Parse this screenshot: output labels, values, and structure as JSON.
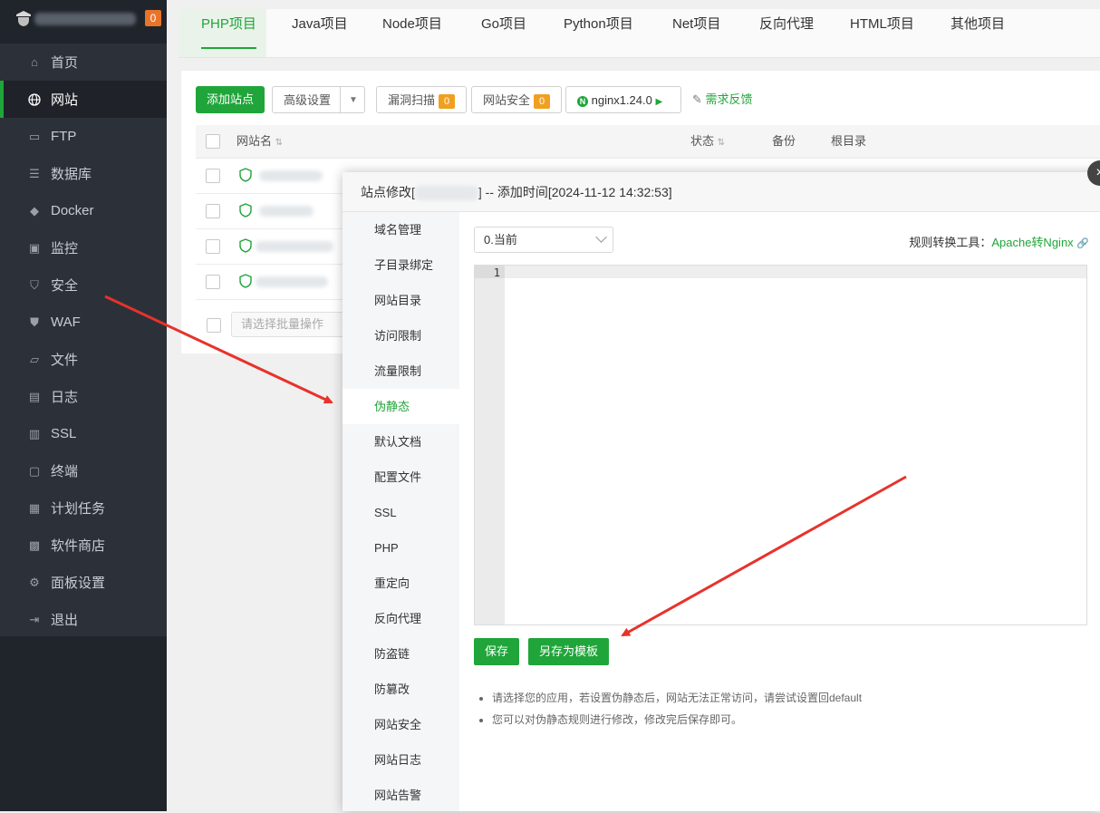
{
  "sidebar": {
    "badge": "0",
    "items": [
      {
        "label": "首页",
        "icon": "home-icon"
      },
      {
        "label": "网站",
        "icon": "globe-icon"
      },
      {
        "label": "FTP",
        "icon": "ftp-icon"
      },
      {
        "label": "数据库",
        "icon": "database-icon"
      },
      {
        "label": "Docker",
        "icon": "docker-icon"
      },
      {
        "label": "监控",
        "icon": "monitor-icon"
      },
      {
        "label": "安全",
        "icon": "shield-icon"
      },
      {
        "label": "WAF",
        "icon": "waf-icon"
      },
      {
        "label": "文件",
        "icon": "folder-icon"
      },
      {
        "label": "日志",
        "icon": "log-icon"
      },
      {
        "label": "SSL",
        "icon": "ssl-icon"
      },
      {
        "label": "终端",
        "icon": "terminal-icon"
      },
      {
        "label": "计划任务",
        "icon": "calendar-icon"
      },
      {
        "label": "软件商店",
        "icon": "apps-icon"
      },
      {
        "label": "面板设置",
        "icon": "gear-icon"
      },
      {
        "label": "退出",
        "icon": "logout-icon"
      }
    ],
    "active_index": 1
  },
  "tabs": [
    "PHP项目",
    "Java项目",
    "Node项目",
    "Go项目",
    "Python项目",
    "Net项目",
    "反向代理",
    "HTML项目",
    "其他项目"
  ],
  "toolbar": {
    "add_site": "添加站点",
    "advanced": "高级设置",
    "vuln_scan": "漏洞扫描",
    "vuln_count": "0",
    "site_security": "网站安全",
    "security_count": "0",
    "nginx": "nginx1.24.0",
    "feedback": "需求反馈"
  },
  "table": {
    "col_name": "网站名",
    "col_status": "状态",
    "col_backup": "备份",
    "col_root": "根目录",
    "batch_placeholder": "请选择批量操作"
  },
  "modal": {
    "title_prefix": "站点修改[",
    "title_suffix": "] -- 添加时间[2024-11-12 14:32:53]",
    "close": "×",
    "nav": [
      "域名管理",
      "子目录绑定",
      "网站目录",
      "访问限制",
      "流量限制",
      "伪静态",
      "默认文档",
      "配置文件",
      "SSL",
      "PHP",
      "重定向",
      "反向代理",
      "防盗链",
      "防篡改",
      "网站安全",
      "网站日志",
      "网站告警"
    ],
    "nav_active_index": 5,
    "select_value": "0.当前",
    "tool_label": "规则转换工具：",
    "tool_link": "Apache转Nginx",
    "line_number": "1",
    "save": "保存",
    "save_template": "另存为模板",
    "tips": [
      "请选择您的应用，若设置伪静态后，网站无法正常访问，请尝试设置回default",
      "您可以对伪静态规则进行修改，修改完后保存即可。"
    ]
  },
  "colors": {
    "accent": "#20a53a",
    "sidebar_bg": "#2c3139",
    "arrow": "#e8322b"
  }
}
